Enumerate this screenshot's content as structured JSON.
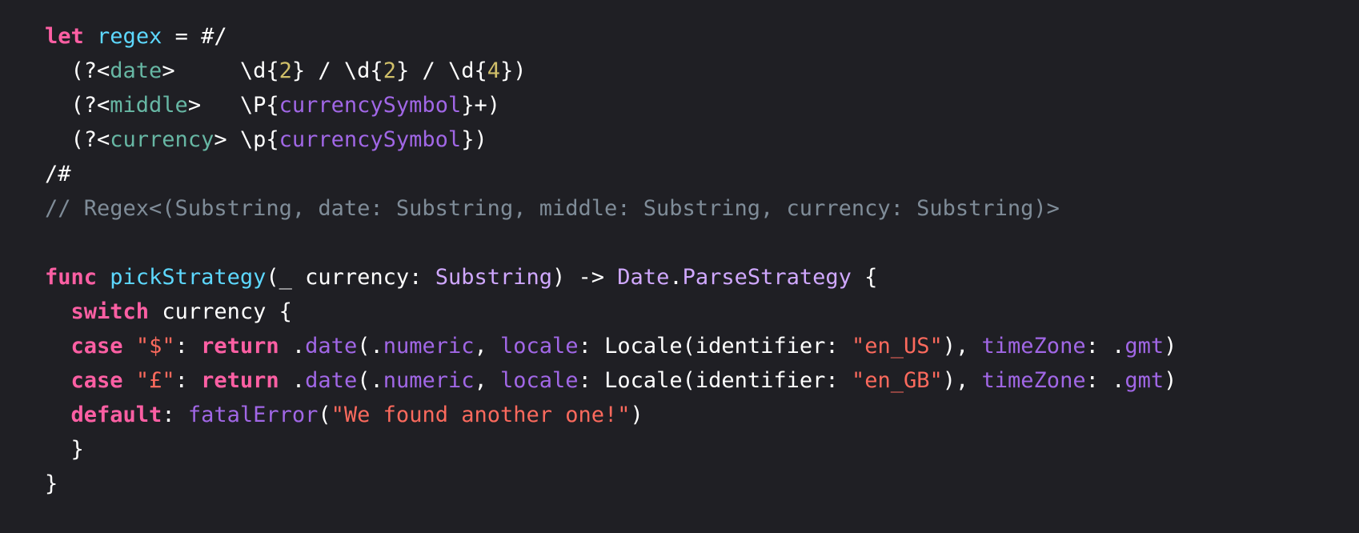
{
  "colors": {
    "background": "#1f1f24",
    "plain": "#ffffff",
    "keyword": "#fc5fa3",
    "declaration": "#5dd8ff",
    "number": "#d0bf69",
    "type": "#d0a8ff",
    "property": "#a167e6",
    "string": "#fc6a5d",
    "comment": "#7f8c98",
    "capture_group": "#67b7a4"
  },
  "code_lines": [
    [
      [
        "kw",
        "let"
      ],
      [
        "plain",
        " "
      ],
      [
        "decl",
        "regex"
      ],
      [
        "plain",
        " = #/"
      ]
    ],
    [
      [
        "plain",
        "  (?<"
      ],
      [
        "group",
        "date"
      ],
      [
        "plain",
        ">     \\d{"
      ],
      [
        "num",
        "2"
      ],
      [
        "plain",
        "} / \\d{"
      ],
      [
        "num",
        "2"
      ],
      [
        "plain",
        "} / \\d{"
      ],
      [
        "num",
        "4"
      ],
      [
        "plain",
        "})"
      ]
    ],
    [
      [
        "plain",
        "  (?<"
      ],
      [
        "group",
        "middle"
      ],
      [
        "plain",
        ">   \\P{"
      ],
      [
        "prop",
        "currencySymbol"
      ],
      [
        "plain",
        "}+)"
      ]
    ],
    [
      [
        "plain",
        "  (?<"
      ],
      [
        "group",
        "currency"
      ],
      [
        "plain",
        "> \\p{"
      ],
      [
        "prop",
        "currencySymbol"
      ],
      [
        "plain",
        "})"
      ]
    ],
    [
      [
        "plain",
        "/#"
      ]
    ],
    [
      [
        "comment",
        "// Regex<(Substring, date: Substring, middle: Substring, currency: Substring)>"
      ]
    ],
    [],
    [
      [
        "kw",
        "func"
      ],
      [
        "plain",
        " "
      ],
      [
        "decl",
        "pickStrategy"
      ],
      [
        "plain",
        "(_ currency: "
      ],
      [
        "type",
        "Substring"
      ],
      [
        "plain",
        ") -> "
      ],
      [
        "type",
        "Date"
      ],
      [
        "plain",
        "."
      ],
      [
        "type",
        "ParseStrategy"
      ],
      [
        "plain",
        " {"
      ]
    ],
    [
      [
        "plain",
        "  "
      ],
      [
        "kw",
        "switch"
      ],
      [
        "plain",
        " currency {"
      ]
    ],
    [
      [
        "plain",
        "  "
      ],
      [
        "kw",
        "case"
      ],
      [
        "plain",
        " "
      ],
      [
        "str",
        "\"$\""
      ],
      [
        "plain",
        ": "
      ],
      [
        "kw",
        "return"
      ],
      [
        "plain",
        " ."
      ],
      [
        "prop",
        "date"
      ],
      [
        "plain",
        "(."
      ],
      [
        "prop",
        "numeric"
      ],
      [
        "plain",
        ", "
      ],
      [
        "prop",
        "locale"
      ],
      [
        "plain",
        ": Locale(identifier: "
      ],
      [
        "str",
        "\"en_US\""
      ],
      [
        "plain",
        "), "
      ],
      [
        "prop",
        "timeZone"
      ],
      [
        "plain",
        ": ."
      ],
      [
        "prop",
        "gmt"
      ],
      [
        "plain",
        ")"
      ]
    ],
    [
      [
        "plain",
        "  "
      ],
      [
        "kw",
        "case"
      ],
      [
        "plain",
        " "
      ],
      [
        "str",
        "\"£\""
      ],
      [
        "plain",
        ": "
      ],
      [
        "kw",
        "return"
      ],
      [
        "plain",
        " ."
      ],
      [
        "prop",
        "date"
      ],
      [
        "plain",
        "(."
      ],
      [
        "prop",
        "numeric"
      ],
      [
        "plain",
        ", "
      ],
      [
        "prop",
        "locale"
      ],
      [
        "plain",
        ": Locale(identifier: "
      ],
      [
        "str",
        "\"en_GB\""
      ],
      [
        "plain",
        "), "
      ],
      [
        "prop",
        "timeZone"
      ],
      [
        "plain",
        ": ."
      ],
      [
        "prop",
        "gmt"
      ],
      [
        "plain",
        ")"
      ]
    ],
    [
      [
        "plain",
        "  "
      ],
      [
        "kw",
        "default"
      ],
      [
        "plain",
        ": "
      ],
      [
        "prop",
        "fatalError"
      ],
      [
        "plain",
        "("
      ],
      [
        "str",
        "\"We found another one!\""
      ],
      [
        "plain",
        ")"
      ]
    ],
    [
      [
        "plain",
        "  }"
      ]
    ],
    [
      [
        "plain",
        "}"
      ]
    ]
  ]
}
